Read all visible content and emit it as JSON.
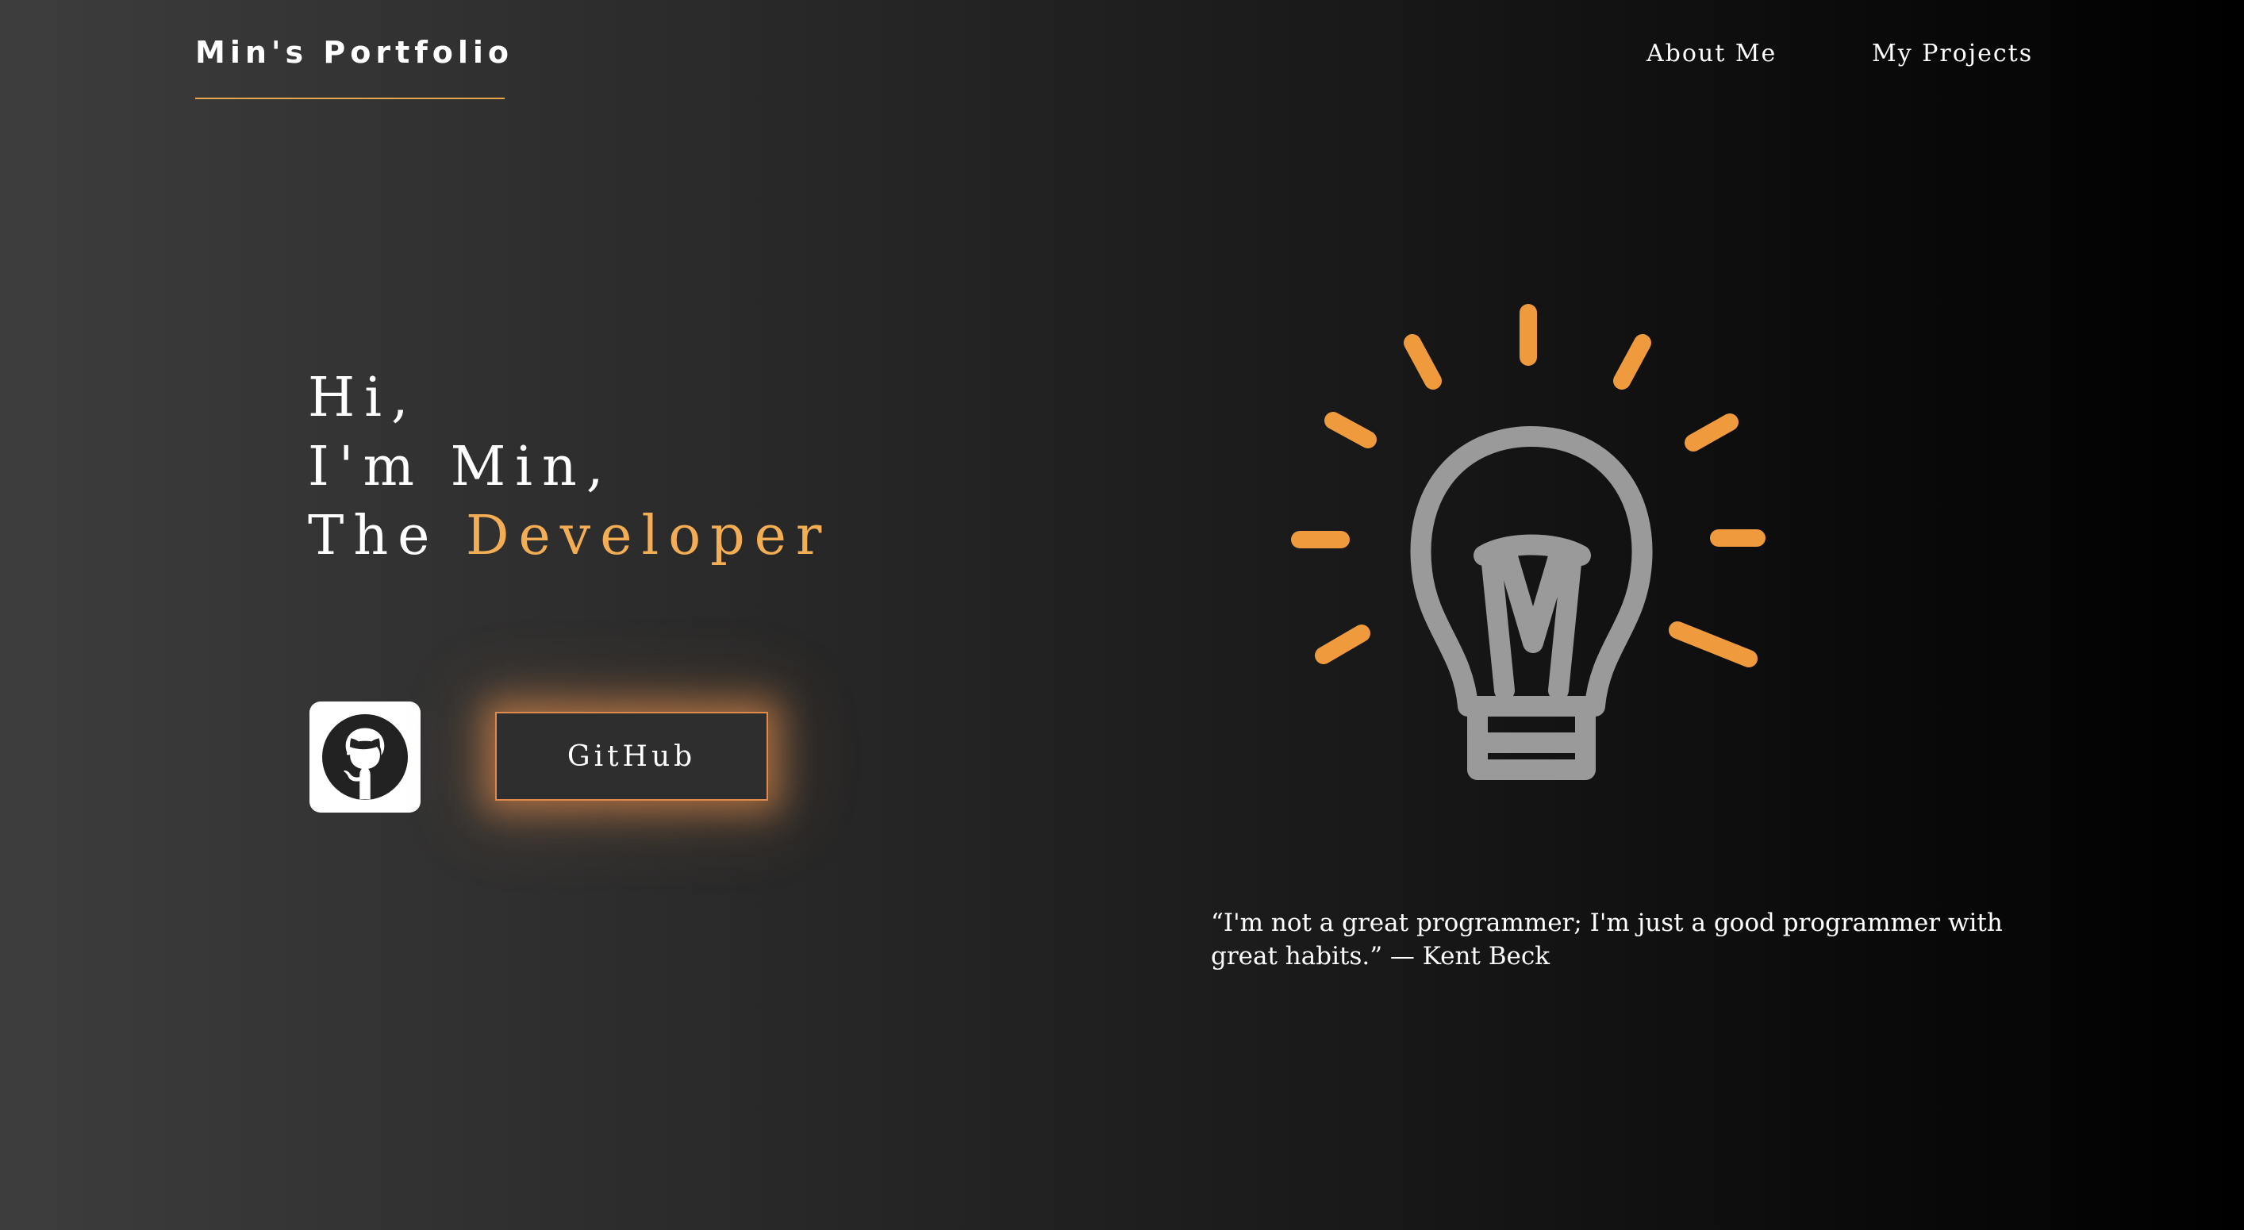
{
  "header": {
    "brand": "Min's Portfolio",
    "nav": [
      {
        "label": "About Me"
      },
      {
        "label": "My Projects"
      }
    ]
  },
  "hero": {
    "line1": "Hi,",
    "line2": "I'm Min,",
    "line3_prefix": "The",
    "line3_accent": "Developer"
  },
  "actions": {
    "github_icon": "github-icon",
    "github_button_label": "GitHub"
  },
  "illustration": {
    "icon": "lightbulb-icon"
  },
  "quote": {
    "text": "“I'm not a great programmer; I'm just a good programmer with great habits.” — Kent Beck"
  },
  "colors": {
    "accent": "#f2ad55",
    "glow": "#e08a4e",
    "bulb_gray": "#9a9a9a",
    "background_start": "#3d3d3d",
    "background_end": "#000000"
  }
}
